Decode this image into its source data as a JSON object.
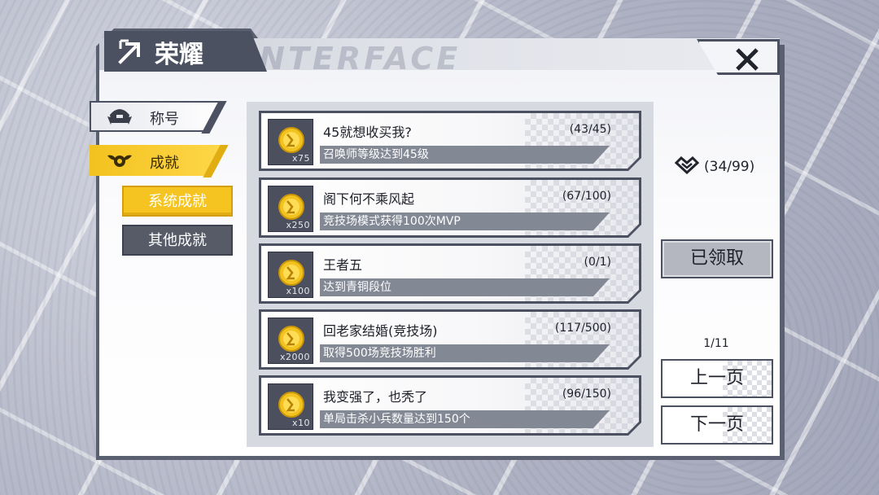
{
  "header": {
    "title": "荣耀",
    "watermark": "INTERFACE",
    "close_icon": "close-x-icon"
  },
  "menu": {
    "items": [
      {
        "label": "称号",
        "icon": "samurai-helmet-icon",
        "active": false
      },
      {
        "label": "成就",
        "icon": "winged-emblem-icon",
        "active": true
      }
    ],
    "sub_items": [
      {
        "label": "系统成就",
        "active": true
      },
      {
        "label": "其他成就",
        "active": false
      }
    ]
  },
  "achievements": [
    {
      "title": "45就想收买我?",
      "progress": "(43/45)",
      "description": "召唤师等级达到45级",
      "reward_count": "x75",
      "reward_icon": "gold-coin-icon"
    },
    {
      "title": "阁下何不乘风起",
      "progress": "(67/100)",
      "description": "竞技场模式获得100次MVP",
      "reward_count": "x250",
      "reward_icon": "gold-coin-icon"
    },
    {
      "title": "王者五",
      "progress": "(0/1)",
      "description": "达到青铜段位",
      "reward_count": "x100",
      "reward_icon": "gold-coin-icon"
    },
    {
      "title": "回老家结婚(竞技场)",
      "progress": "(117/500)",
      "description": "取得500场竞技场胜利",
      "reward_count": "x2000",
      "reward_icon": "gold-coin-icon"
    },
    {
      "title": "我变强了，也秃了",
      "progress": "(96/150)",
      "description": "单局击杀小兵数量达到150个",
      "reward_count": "x10",
      "reward_icon": "gold-coin-icon"
    }
  ],
  "sidebar_right": {
    "honor_count": "(34/99)",
    "honor_icon": "honor-heart-icon",
    "claimed_label": "已领取",
    "page_indicator": "1/11",
    "prev_label": "上一页",
    "next_label": "下一页"
  },
  "colors": {
    "frame": "#4c5162",
    "accent_yellow": "#f5c420",
    "coin": "#f2c21e"
  }
}
